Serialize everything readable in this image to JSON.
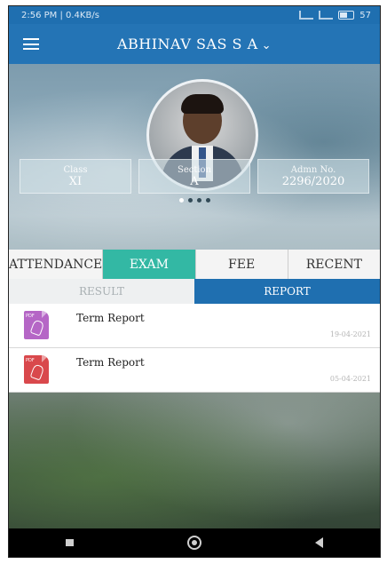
{
  "status_bar": {
    "time_speed": "2:56 PM | 0.4KB/s",
    "battery": "57"
  },
  "header": {
    "title": "ABHINAV SAS S A"
  },
  "profile": {
    "cards": [
      {
        "label": "Class",
        "value": "XI"
      },
      {
        "label": "Section",
        "value": "A"
      },
      {
        "label": "Admn No.",
        "value": "2296/2020"
      }
    ]
  },
  "tabs": [
    "ATTENDANCE",
    "EXAM",
    "FEE",
    "RECENT"
  ],
  "active_tab": "EXAM",
  "subtabs": [
    "RESULT",
    "REPORT"
  ],
  "active_subtab": "REPORT",
  "reports": [
    {
      "title": "Term Report",
      "date": "19-04-2021",
      "icon_color": "#b566c6"
    },
    {
      "title": "Term Report",
      "date": "05-04-2021",
      "icon_color": "#d9484c"
    }
  ],
  "colors": {
    "primary": "#2474b5",
    "accent": "#33b8a4"
  }
}
